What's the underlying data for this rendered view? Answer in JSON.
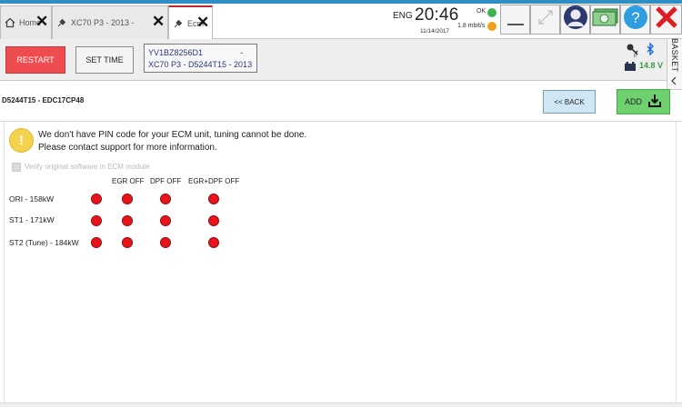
{
  "tabs": [
    {
      "label": "Home",
      "icon": "home-icon",
      "active": false
    },
    {
      "label": "XC70 P3 - 2013 -",
      "icon": "car-plug-icon",
      "active": false
    },
    {
      "label": "Ecm",
      "icon": "ecm-plug-icon",
      "active": true
    }
  ],
  "status": {
    "language": "ENG",
    "time": "20:46",
    "date": "11/14/2017",
    "connection": "OK",
    "speed": "1.8 mbit/s",
    "connection_color": "#3fb34f",
    "speed_color": "#f0a21b"
  },
  "top_buttons": [
    "minimize-icon",
    "resize-icon",
    "user-icon",
    "money-icon",
    "help-icon",
    "exit-icon"
  ],
  "toolbar": {
    "restart_label": "RESTART",
    "settime_label": "SET TIME",
    "vin": "YV1BZ8256D1",
    "vin_suffix": "-",
    "vehicle": "XC70 P3 - D5244T15 - 2013",
    "voltage": "14.8 V"
  },
  "basket": {
    "label": "BASKET"
  },
  "header": {
    "ecm_title": "D5244T15 - EDC17CP48",
    "back_label": "<< BACK",
    "add_label": "ADD"
  },
  "warning": {
    "icon": "!",
    "text": "We don't have PIN code for your ECM unit, tuning cannot be done. Please contact support for more information."
  },
  "verify": {
    "label": "Verify original software in ECM module",
    "checked": false,
    "enabled": false
  },
  "options": {
    "columns": [
      "EGR OFF",
      "DPF OFF",
      "EGR+DPF OFF"
    ],
    "rows": [
      {
        "label": "ORI - 158kW"
      },
      {
        "label": "ST1 - 171kW"
      },
      {
        "label": "ST2 (Tune) - 184kW"
      }
    ],
    "dot_color": "#e8141c"
  }
}
